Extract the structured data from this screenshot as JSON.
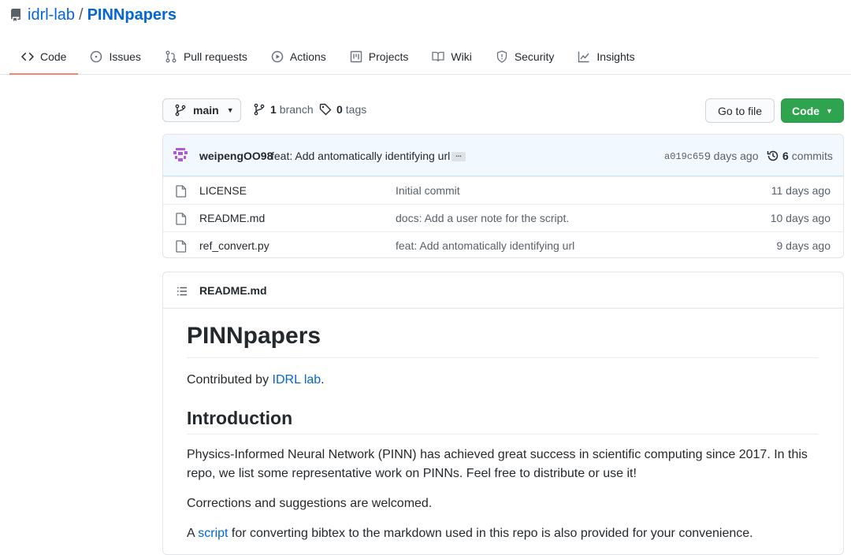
{
  "repo": {
    "owner": "idrl-lab",
    "separator": "/",
    "name": "PINNpapers"
  },
  "tabs": [
    {
      "label": "Code",
      "icon": "code-icon"
    },
    {
      "label": "Issues",
      "icon": "issue-icon"
    },
    {
      "label": "Pull requests",
      "icon": "pull-request-icon"
    },
    {
      "label": "Actions",
      "icon": "play-icon"
    },
    {
      "label": "Projects",
      "icon": "project-icon"
    },
    {
      "label": "Wiki",
      "icon": "book-icon"
    },
    {
      "label": "Security",
      "icon": "shield-icon"
    },
    {
      "label": "Insights",
      "icon": "graph-icon"
    }
  ],
  "branch_bar": {
    "branch": "main",
    "branch_count": "1",
    "branch_label": "branch",
    "tag_count": "0",
    "tag_label": "tags",
    "goto_file": "Go to file",
    "code_button": "Code"
  },
  "latest_commit": {
    "author": "weipengOO98",
    "message": "feat: Add antomatically identifying url",
    "ellipsis": "...",
    "sha": "a019c65",
    "time": "9 days ago",
    "count": "6",
    "count_label": "commits"
  },
  "files": [
    {
      "name": "LICENSE",
      "message": "Initial commit",
      "age": "11 days ago"
    },
    {
      "name": "README.md",
      "message": "docs: Add a user note for the script.",
      "age": "10 days ago"
    },
    {
      "name": "ref_convert.py",
      "message": "feat: Add antomatically identifying url",
      "age": "9 days ago"
    }
  ],
  "readme": {
    "filename": "README.md",
    "title": "PINNpapers",
    "contrib_prefix": "Contributed by ",
    "contrib_link": "IDRL lab",
    "contrib_suffix": ".",
    "intro_heading": "Introduction",
    "intro_text": "Physics-Informed Neural Network (PINN) has achieved great success in scientific computing since 2017. In this repo, we list some representative work on PINNs. Feel free to distribute or use it!",
    "corrections_text": "Corrections and suggestions are welcomed.",
    "script_prefix": "A ",
    "script_link": "script",
    "script_suffix": " for converting bibtex to the markdown used in this repo is also provided for your convenience."
  },
  "colors": {
    "link": "#0366d6",
    "primary_button": "#2ea44f",
    "tab_underline": "#f9826c",
    "commit_bar": "#f1f8ff"
  }
}
